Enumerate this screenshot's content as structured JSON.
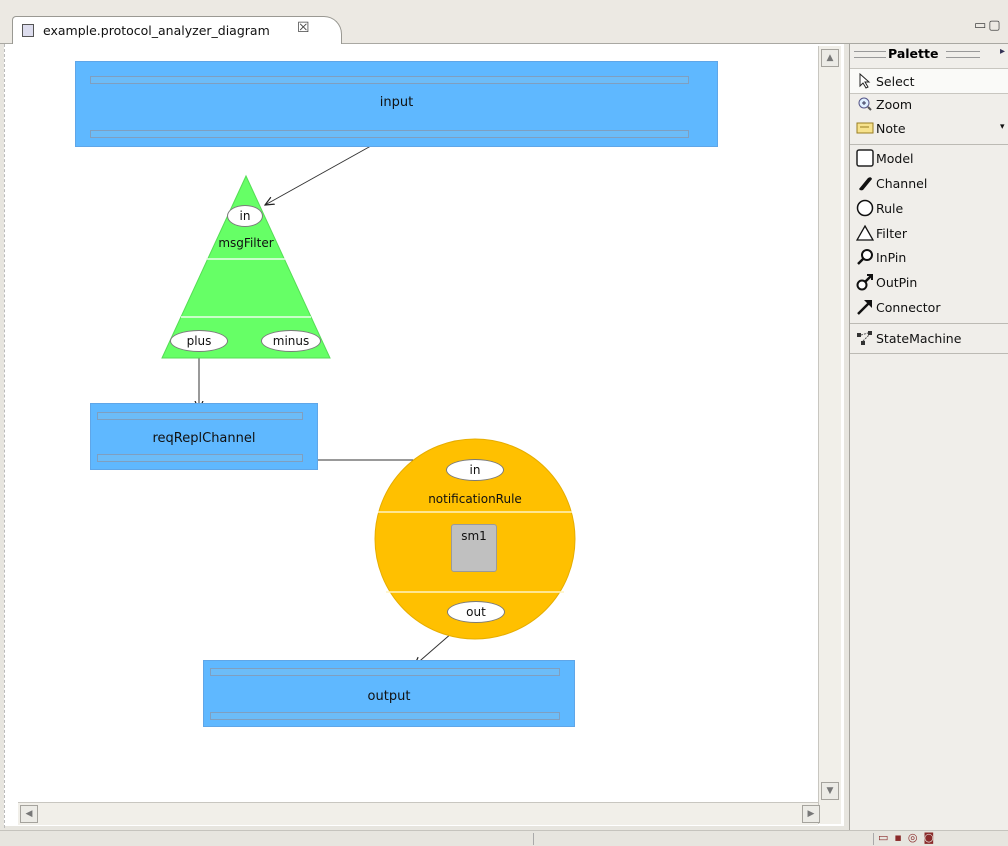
{
  "editor_tab": {
    "title": "example.protocol_analyzer_diagram",
    "close_glyph": "☒"
  },
  "window_buttons": "▭▢",
  "diagram": {
    "input_block": {
      "label": "input"
    },
    "filter": {
      "label": "msgFilter",
      "pin_in": "in",
      "pin_plus": "plus",
      "pin_minus": "minus"
    },
    "channel": {
      "label": "reqReplChannel"
    },
    "rule": {
      "label": "notificationRule",
      "pin_in": "in",
      "pin_out": "out",
      "state_machine": "sm1"
    },
    "output_block": {
      "label": "output"
    }
  },
  "palette": {
    "title": "Palette",
    "tools": [
      {
        "label": "Select",
        "icon": "arrow-cursor-icon"
      },
      {
        "label": "Zoom",
        "icon": "zoom-icon"
      },
      {
        "label": "Note",
        "icon": "note-icon"
      }
    ],
    "elements": [
      {
        "label": "Model",
        "icon": "square-icon"
      },
      {
        "label": "Channel",
        "icon": "channel-icon"
      },
      {
        "label": "Rule",
        "icon": "circle-icon"
      },
      {
        "label": "Filter",
        "icon": "triangle-icon"
      },
      {
        "label": "InPin",
        "icon": "inpin-icon"
      },
      {
        "label": "OutPin",
        "icon": "outpin-icon"
      },
      {
        "label": "Connector",
        "icon": "connector-arrow-icon"
      }
    ],
    "extras": [
      {
        "label": "StateMachine",
        "icon": "statemachine-icon"
      }
    ]
  },
  "colors": {
    "block": "#5fb8ff",
    "filter": "#66ff66",
    "rule": "#ffc000",
    "state": "#c0c0c0"
  }
}
